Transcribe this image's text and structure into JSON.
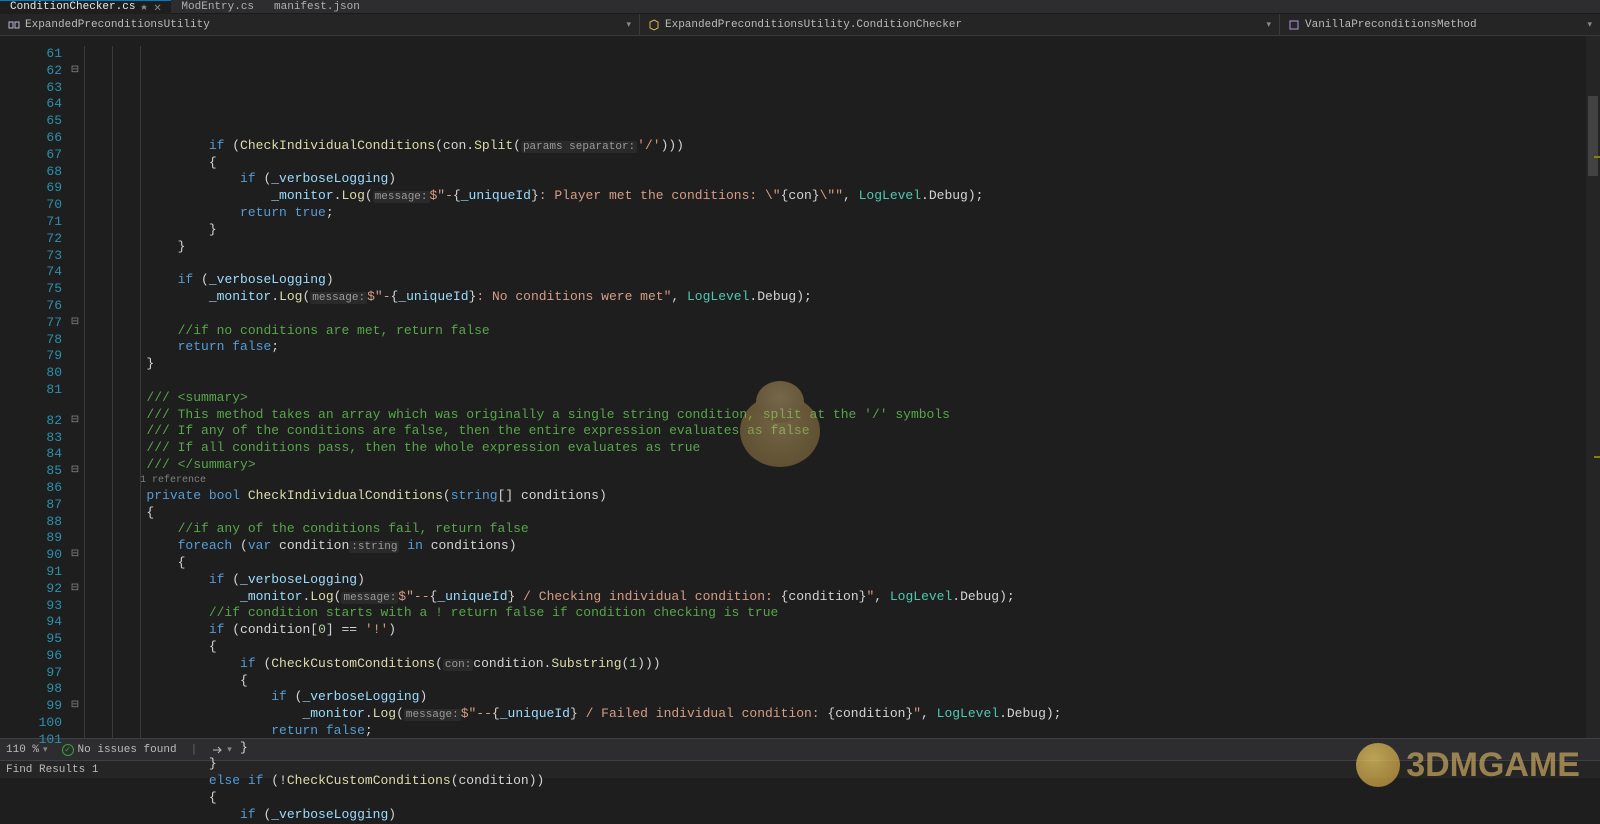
{
  "tabs": [
    {
      "label": "ConditionChecker.cs",
      "active": true
    },
    {
      "label": "ModEntry.cs",
      "active": false
    },
    {
      "label": "manifest.json",
      "active": false
    }
  ],
  "breadcrumb": {
    "namespace": "ExpandedPreconditionsUtility",
    "class": "ExpandedPreconditionsUtility.ConditionChecker",
    "method": "VanillaPreconditionsMethod"
  },
  "status": {
    "zoom": "110 %",
    "issues": "No issues found"
  },
  "bottom_panel": "Find Results 1",
  "watermark": "3DMGAME",
  "codelens": "1 reference",
  "lines": [
    {
      "n": 61,
      "fold": "",
      "html": ""
    },
    {
      "n": 62,
      "fold": "⊟",
      "html": "                <span class='k'>if</span> (<span class='m'>CheckIndividualConditions</span>(con.<span class='m'>Split</span>(<span class='p'>params separator:</span><span class='s'>'/'</span>)))"
    },
    {
      "n": 63,
      "fold": "",
      "html": "                {"
    },
    {
      "n": 64,
      "fold": "",
      "html": "                    <span class='k'>if</span> (<span class='f'>_verboseLogging</span>)"
    },
    {
      "n": 65,
      "fold": "",
      "html": "                        <span class='f'>_monitor</span>.<span class='m'>Log</span>(<span class='p'>message:</span><span class='s'>$\"-</span>{<span class='f'>_uniqueId</span>}<span class='s'>: Player met the conditions: \\\"</span>{con}<span class='s'>\\\"\"</span>, <span class='t'>LogLevel</span>.Debug);"
    },
    {
      "n": 66,
      "fold": "",
      "html": "                    <span class='k'>return</span> <span class='k'>true</span>;"
    },
    {
      "n": 67,
      "fold": "",
      "html": "                }"
    },
    {
      "n": 68,
      "fold": "",
      "html": "            }"
    },
    {
      "n": 69,
      "fold": "",
      "html": ""
    },
    {
      "n": 70,
      "fold": "",
      "html": "            <span class='k'>if</span> (<span class='f'>_verboseLogging</span>)"
    },
    {
      "n": 71,
      "fold": "",
      "html": "                <span class='f'>_monitor</span>.<span class='m'>Log</span>(<span class='p'>message:</span><span class='s'>$\"-</span>{<span class='f'>_uniqueId</span>}<span class='s'>: No conditions were met\"</span>, <span class='t'>LogLevel</span>.Debug);"
    },
    {
      "n": 72,
      "fold": "",
      "html": ""
    },
    {
      "n": 73,
      "fold": "",
      "html": "            <span class='c'>//if no conditions are met, return false</span>"
    },
    {
      "n": 74,
      "fold": "",
      "html": "            <span class='k'>return</span> <span class='k'>false</span>;"
    },
    {
      "n": 75,
      "fold": "",
      "html": "        }"
    },
    {
      "n": 76,
      "fold": "",
      "html": ""
    },
    {
      "n": 77,
      "fold": "⊟",
      "html": "        <span class='c'>/// &lt;summary&gt;</span>"
    },
    {
      "n": 78,
      "fold": "",
      "html": "        <span class='c'>/// This method takes an array which was originally a single string condition, split at the '/' symbols</span>"
    },
    {
      "n": 79,
      "fold": "",
      "html": "        <span class='c'>/// If any of the conditions are false, then the entire expression evaluates as false</span>"
    },
    {
      "n": 80,
      "fold": "",
      "html": "        <span class='c'>/// If all conditions pass, then the whole expression evaluates as true</span>"
    },
    {
      "n": 81,
      "fold": "",
      "html": "        <span class='c'>/// &lt;/summary&gt;</span>"
    },
    {
      "n": 82,
      "fold": "⊟",
      "html": "        <span class='k'>private</span> <span class='k'>bool</span> <span class='m'>CheckIndividualConditions</span>(<span class='k'>string</span>[] conditions)",
      "codelens": true
    },
    {
      "n": 83,
      "fold": "",
      "html": "        {"
    },
    {
      "n": 84,
      "fold": "",
      "html": "            <span class='c'>//if any of the conditions fail, return false</span>"
    },
    {
      "n": 85,
      "fold": "⊟",
      "html": "            <span class='k'>foreach</span> (<span class='k'>var</span> condition<span class='p'>:string</span> <span class='k'>in</span> conditions)"
    },
    {
      "n": 86,
      "fold": "",
      "html": "            {"
    },
    {
      "n": 87,
      "fold": "",
      "html": "                <span class='k'>if</span> (<span class='f'>_verboseLogging</span>)"
    },
    {
      "n": 88,
      "fold": "",
      "html": "                    <span class='f'>_monitor</span>.<span class='m'>Log</span>(<span class='p'>message:</span><span class='s'>$\"--</span>{<span class='f'>_uniqueId</span>}<span class='s'> / Checking individual condition: </span>{condition}<span class='s'>\"</span>, <span class='t'>LogLevel</span>.Debug);"
    },
    {
      "n": 89,
      "fold": "",
      "html": "                <span class='c'>//if condition starts with a ! return false if condition checking is true</span>"
    },
    {
      "n": 90,
      "fold": "⊟",
      "html": "                <span class='k'>if</span> (condition[<span class='n'>0</span>] == <span class='s'>'!'</span>)"
    },
    {
      "n": 91,
      "fold": "",
      "html": "                {"
    },
    {
      "n": 92,
      "fold": "⊟",
      "html": "                    <span class='k'>if</span> (<span class='m'>CheckCustomConditions</span>(<span class='p'>con:</span>condition.<span class='m'>Substring</span>(<span class='n'>1</span>)))"
    },
    {
      "n": 93,
      "fold": "",
      "html": "                    {"
    },
    {
      "n": 94,
      "fold": "",
      "html": "                        <span class='k'>if</span> (<span class='f'>_verboseLogging</span>)"
    },
    {
      "n": 95,
      "fold": "",
      "html": "                            <span class='f'>_monitor</span>.<span class='m'>Log</span>(<span class='p'>message:</span><span class='s'>$\"--</span>{<span class='f'>_uniqueId</span>}<span class='s'> / Failed individual condition: </span>{condition}<span class='s'>\"</span>, <span class='t'>LogLevel</span>.Debug);"
    },
    {
      "n": 96,
      "fold": "",
      "html": "                        <span class='k'>return</span> <span class='k'>false</span>;"
    },
    {
      "n": 97,
      "fold": "",
      "html": "                    }"
    },
    {
      "n": 98,
      "fold": "",
      "html": "                }"
    },
    {
      "n": 99,
      "fold": "⊟",
      "html": "                <span class='k'>else</span> <span class='k'>if</span> (!<span class='m'>CheckCustomConditions</span>(condition))"
    },
    {
      "n": 100,
      "fold": "",
      "html": "                {"
    },
    {
      "n": 101,
      "fold": "",
      "html": "                    <span class='k'>if</span> (<span class='f'>_verboseLogging</span>)"
    }
  ]
}
